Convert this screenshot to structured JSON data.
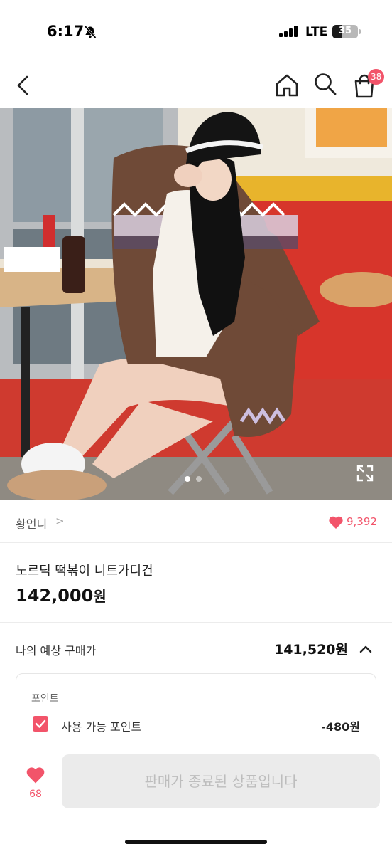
{
  "status_bar": {
    "time": "6:17",
    "network": "LTE",
    "battery": "35",
    "battery_level_percent": 35
  },
  "nav": {
    "cart_badge": "38"
  },
  "gallery": {
    "page_count": 2,
    "current_page": 1
  },
  "seller": {
    "name": "황언니",
    "chevron": ">",
    "like_count": "9,392"
  },
  "product": {
    "title": "노르딕 떡볶이 니트가디건",
    "price": "142,000",
    "price_unit": "원"
  },
  "expected_price": {
    "label": "나의 예상 구매가",
    "value": "141,520원"
  },
  "points": {
    "title": "포인트",
    "available_label": "사용 가능 포인트",
    "available_value": "-480원",
    "checked": true
  },
  "bottom": {
    "favorite_count": "68",
    "button_label": "판매가 종료된 상품입니다"
  },
  "colors": {
    "accent": "#f2546a",
    "disabled_bg": "#ebebeb",
    "disabled_text": "#bdbdbd"
  }
}
